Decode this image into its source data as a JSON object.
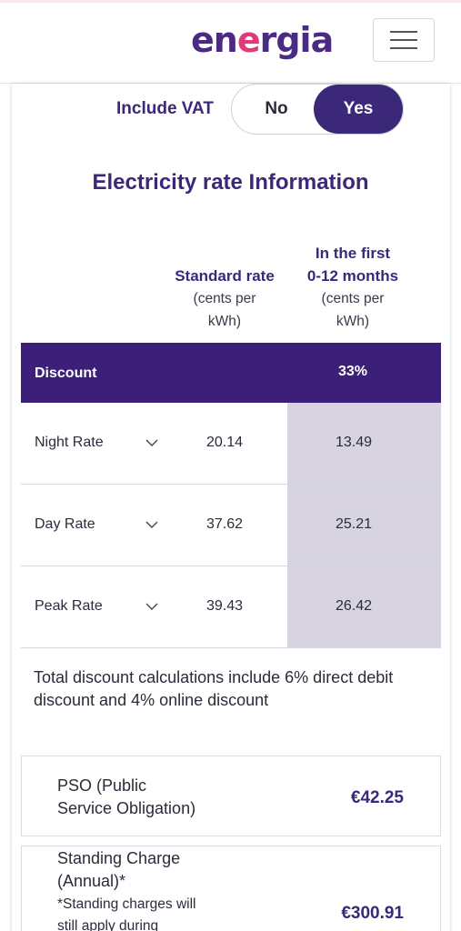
{
  "header": {
    "logo_prefix": "en",
    "logo_accent": "e",
    "logo_suffix": "rgia",
    "menu_icon": "hamburger-icon"
  },
  "vat": {
    "label": "Include VAT",
    "options": [
      "No",
      "Yes"
    ],
    "selected": "Yes"
  },
  "section_title": "Electricity rate Information",
  "columns": {
    "standard": {
      "title": "Standard rate",
      "unit_line1": "(cents per",
      "unit_line2": "kWh)"
    },
    "first": {
      "title_line1": "In the first",
      "title_line2": "0-12 months",
      "unit_line1": "(cents per",
      "unit_line2": "kWh)"
    }
  },
  "discount": {
    "label": "Discount",
    "value": "33%"
  },
  "rates": [
    {
      "name": "Night Rate",
      "standard": "20.14",
      "first": "13.49"
    },
    {
      "name": "Day Rate",
      "standard": "37.62",
      "first": "25.21"
    },
    {
      "name": "Peak Rate",
      "standard": "39.43",
      "first": "26.42"
    }
  ],
  "note": "Total discount calculations include 6% direct debit discount and 4% online discount",
  "charges": [
    {
      "title_line1": "PSO (Public",
      "title_line2": "Service Obligation)",
      "price": "€42.25"
    },
    {
      "title_line1": "Standing Charge",
      "title_line2": "(Annual)*",
      "sub_line1": "*Standing charges will",
      "sub_line2": "still apply during",
      "price": "€300.91"
    }
  ],
  "colors": {
    "brand_purple": "#3b2878",
    "accent_pink": "#e03a7a",
    "shade": "#d8d3e1"
  }
}
